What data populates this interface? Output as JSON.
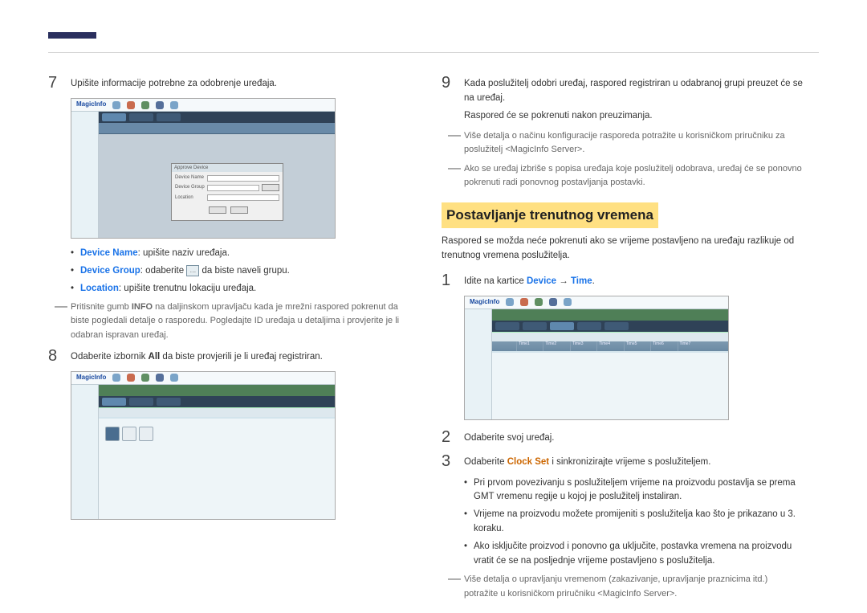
{
  "left": {
    "step7": {
      "num": "7",
      "text": "Upišite informacije potrebne za odobrenje uređaja."
    },
    "bullets": [
      {
        "label": "Device Name",
        "rest": ": upišite naziv uređaja."
      },
      {
        "label": "Device Group",
        "rest": ": odaberite ",
        "tail": " da biste naveli grupu.",
        "icon": "…"
      },
      {
        "label": "Location",
        "rest": ": upišite trenutnu lokaciju uređaja."
      }
    ],
    "note7a_pre": "Pritisnite gumb ",
    "note7a_bold": "INFO",
    "note7a_post": " na daljinskom upravljaču kada je mrežni raspored pokrenut da biste pogledali detalje o rasporedu. Pogledajte ID uređaja u detaljima i provjerite je li odabran ispravan uređaj.",
    "step8": {
      "num": "8",
      "pre": "Odaberite izbornik ",
      "bold": "All",
      "post": " da biste provjerili je li uređaj registriran."
    },
    "shot1": {
      "logo": "MagicInfo",
      "dlg_title": "Approve Device",
      "dlg_rows": [
        "Device Name",
        "Device Group",
        "Location"
      ]
    },
    "shot2": {
      "logo": "MagicInfo"
    }
  },
  "right": {
    "step9": {
      "num": "9",
      "l1": "Kada poslužitelj odobri uređaj, raspored registriran u odabranoj grupi preuzet će se na uređaj.",
      "l2": "Raspored će se pokrenuti nakon preuzimanja."
    },
    "note9a": "Više detalja o načinu konfiguracije rasporeda potražite u korisničkom priručniku za poslužitelj <MagicInfo Server>.",
    "note9b": "Ako se uređaj izbriše s popisa uređaja koje poslužitelj odobrava, uređaj će se ponovno pokrenuti radi ponovnog postavljanja postavki.",
    "heading": "Postavljanje trenutnog vremena",
    "intro": "Raspored se možda neće pokrenuti ako se vrijeme postavljeno na uređaju razlikuje od trenutnog vremena poslužitelja.",
    "step1": {
      "num": "1",
      "pre": "Idite na kartice ",
      "b1": "Device",
      "arrow": " → ",
      "b2": "Time",
      "post": "."
    },
    "step2": {
      "num": "2",
      "text": "Odaberite svoj uređaj."
    },
    "step3": {
      "num": "3",
      "pre": "Odaberite ",
      "b": "Clock Set",
      "post": " i sinkronizirajte vrijeme s poslužiteljem."
    },
    "sub_bullets": [
      "Pri prvom povezivanju s poslužiteljem vrijeme na proizvodu postavlja se prema GMT vremenu regije u kojoj je poslužitelj instaliran.",
      "Vrijeme na proizvodu možete promijeniti s poslužitelja kao što je prikazano u 3. koraku.",
      "Ako isključite proizvod i ponovno ga uključite, postavka vremena na proizvodu vratit će se na posljednje vrijeme postavljeno s poslužitelja."
    ],
    "note_end": "Više detalja o upravljanju vremenom (zakazivanje, upravljanje praznicima itd.) potražite u korisničkom priručniku <MagicInfo Server>.",
    "shot3": {
      "logo": "MagicInfo",
      "timecols": [
        "Time1",
        "Time2",
        "Time3",
        "Time4",
        "Time5",
        "Time6",
        "Time7"
      ]
    }
  }
}
